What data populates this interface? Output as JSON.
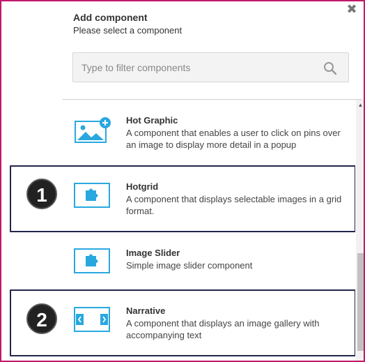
{
  "header": {
    "title": "Add component",
    "subtitle": "Please select a component",
    "close_icon": "close-icon"
  },
  "search": {
    "placeholder": "Type to filter components",
    "value": "",
    "icon": "search-icon"
  },
  "components": [
    {
      "title": "Hot Graphic",
      "description": "A component that enables a user to click on pins over an image to display more detail in a popup",
      "icon": "image-plus-icon"
    },
    {
      "title": "Hotgrid",
      "description": "A component that displays selectable images in a grid format.",
      "icon": "puzzle-icon"
    },
    {
      "title": "Image Slider",
      "description": "Simple image slider component",
      "icon": "puzzle-icon"
    },
    {
      "title": "Narrative",
      "description": "A component that displays an image gallery with accompanying text",
      "icon": "slider-arrows-icon"
    }
  ],
  "annotations": [
    {
      "label": "1"
    },
    {
      "label": "2"
    }
  ],
  "colors": {
    "frame_border": "#c2186b",
    "icon_accent": "#29a8e0",
    "highlight_border": "#23264a",
    "badge_bg": "#222222"
  }
}
